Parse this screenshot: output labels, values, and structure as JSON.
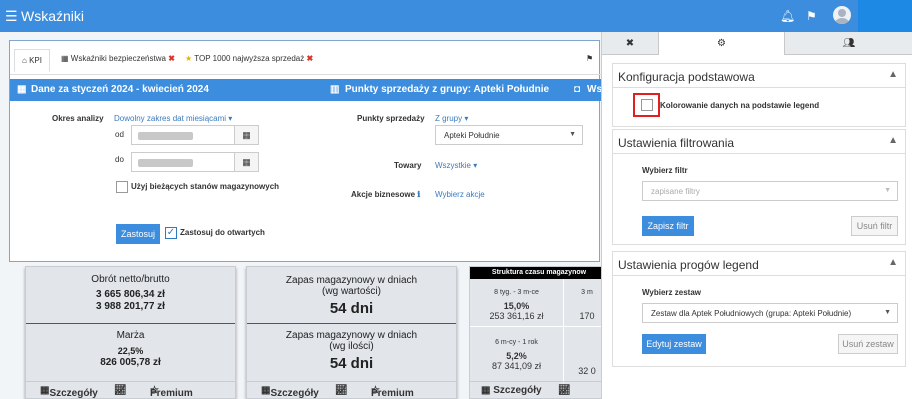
{
  "app": {
    "title": "Wskaźniki"
  },
  "icons": {
    "menu": "hamburger-icon",
    "bell": "bell-icon",
    "flag": "flag-icon",
    "user": "avatar-icon"
  },
  "tabs": [
    {
      "label": "KPI"
    },
    {
      "label": "Wskaźniki bezpieczeństwa"
    },
    {
      "label": "TOP 1000 najwyższa sprzedaż"
    }
  ],
  "bar": {
    "date_range": "Dane za styczeń 2024 - kwiecień 2024",
    "points": "Punkty sprzedaży z grupy: Apteki Południe",
    "extra": "Ws"
  },
  "filters": {
    "period_label": "Okres analizy",
    "period_link": "Dowolny zakres dat miesiącami",
    "from_label": "od",
    "to_label": "do",
    "current_stock_label": "Użyj bieżących stanów magazynowych",
    "points_label": "Punkty sprzedaży",
    "points_link": "Z grupy",
    "points_value": "Apteki Południe",
    "goods_label": "Towary",
    "goods_link": "Wszystkie",
    "actions_label": "Akcje biznesowe",
    "actions_link": "Wybierz akcje",
    "apply_button": "Zastosuj",
    "apply_open_label": "Zastosuj do otwartych"
  },
  "cards": [
    {
      "top_title": "Obrót netto/brutto",
      "top_values": [
        "3 665 806,34 zł",
        "3 988 201,77 zł"
      ],
      "bottom_title": "Marża",
      "bottom_values": [
        "22,5%",
        "826 005,78 zł"
      ],
      "details": "Szczegóły",
      "premium": "Premium"
    },
    {
      "top_title": "Zapas magazynowy w dniach",
      "top_sub": "(wg wartości)",
      "top_value": "54 dni",
      "bottom_title": "Zapas magazynowy w dniach",
      "bottom_sub": "(wg ilości)",
      "bottom_value": "54 dni",
      "details": "Szczegóły",
      "premium": "Premium"
    }
  ],
  "structure_card": {
    "title": "Struktura czasu magazynow",
    "cells": [
      {
        "label": "8 tyg. - 3 m-ce",
        "pct": "15,0%",
        "value": "253 361,16 zł"
      },
      {
        "label": "3 m",
        "pct": "",
        "value": "170"
      },
      {
        "label": "6 m-cy - 1 rok",
        "pct": "5,2%",
        "value": "87 341,09 zł"
      },
      {
        "label": "",
        "pct": "",
        "value": "32 0"
      }
    ],
    "details": "Szczegóły"
  },
  "panel": {
    "tabs": [
      {
        "icon": "close-icon"
      },
      {
        "icon": "gear-icon"
      },
      {
        "icon": "users-icon"
      }
    ],
    "basic": {
      "title": "Konfiguracja podstawowa",
      "coloring_label": "Kolorowanie danych na podstawie legend"
    },
    "filter": {
      "title": "Ustawienia filtrowania",
      "choose_label": "Wybierz filtr",
      "placeholder": "zapisane filtry",
      "save_button": "Zapisz filtr",
      "delete_button": "Usuń filtr"
    },
    "legend": {
      "title": "Ustawienia progów legend",
      "choose_label": "Wybierz zestaw",
      "value": "Zestaw dla Aptek Południowych (grupa: Apteki Południe)",
      "edit_button": "Edytuj zestaw",
      "delete_button": "Usuń zestaw"
    }
  },
  "colors": {
    "accent": "#3c8dde",
    "highlight": "#e02020"
  }
}
